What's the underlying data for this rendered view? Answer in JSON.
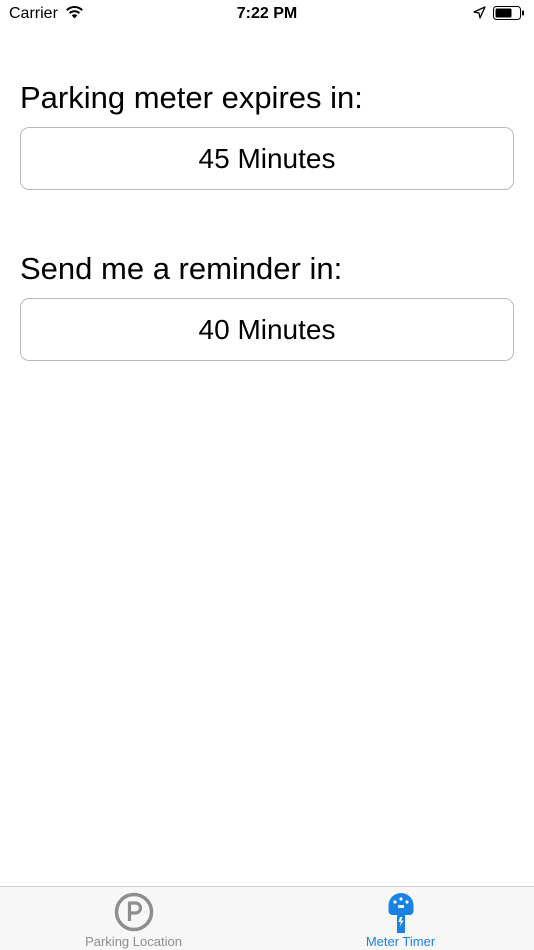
{
  "status_bar": {
    "carrier": "Carrier",
    "time": "7:22 PM"
  },
  "meter": {
    "expires_label": "Parking meter expires in:",
    "expires_value": "45 Minutes",
    "reminder_label": "Send me a reminder in:",
    "reminder_value": "40 Minutes"
  },
  "tab_bar": {
    "tabs": [
      {
        "label": "Parking Location",
        "icon": "parking-icon",
        "active": false
      },
      {
        "label": "Meter Timer",
        "icon": "parking-meter-icon",
        "active": true
      }
    ]
  },
  "colors": {
    "accent": "#1a82e2",
    "inactive_tab": "#8e8e8e",
    "field_border": "#b9b9b9"
  }
}
